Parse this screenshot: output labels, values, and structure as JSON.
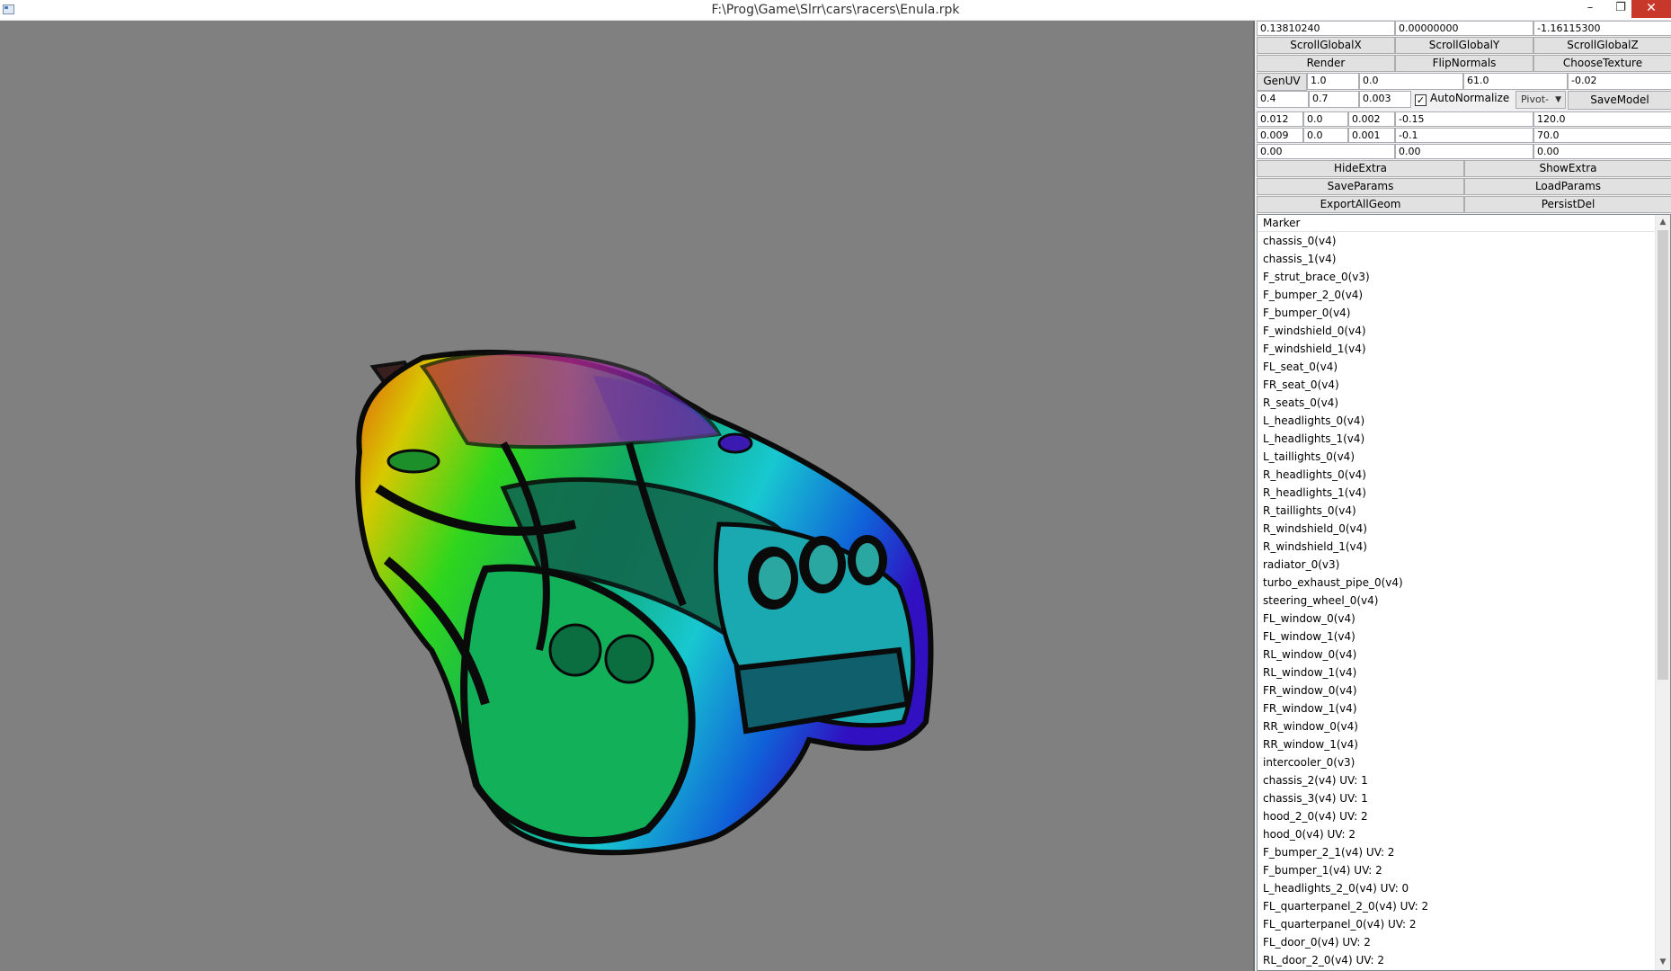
{
  "window": {
    "title": "F:\\Prog\\Game\\Slrr\\cars\\racers\\Enula.rpk",
    "min_glyph": "–",
    "max_glyph": "❐",
    "close_glyph": "✕"
  },
  "panel": {
    "coords": [
      "0.13810240",
      "0.00000000",
      "-1.16115300"
    ],
    "scroll_buttons": [
      "ScrollGlobalX",
      "ScrollGlobalY",
      "ScrollGlobalZ"
    ],
    "action_buttons": [
      "Render",
      "FlipNormals",
      "ChooseTexture"
    ],
    "genuv_label": "GenUV",
    "genuv_row": [
      "1.0",
      "0.0",
      "61.0",
      "-0.02"
    ],
    "param_row": [
      "0.4",
      "0.7",
      "0.003"
    ],
    "autonormalize_label": "AutoNormalize",
    "autonormalize_checked": true,
    "pivot_value": "Pivot-",
    "save_model_label": "SaveModel",
    "row_a": [
      "0.012",
      "0.0",
      "0.002",
      "-0.15",
      "120.0"
    ],
    "row_b": [
      "0.009",
      "0.0",
      "0.001",
      "-0.1",
      "70.0"
    ],
    "row_c": [
      "0.00",
      "0.00",
      "0.00"
    ],
    "hide_extra_label": "HideExtra",
    "show_extra_label": "ShowExtra",
    "save_params_label": "SaveParams",
    "load_params_label": "LoadParams",
    "export_all_geom_label": "ExportAllGeom",
    "persist_del_label": "PersistDel"
  },
  "marker_list": {
    "header": "Marker",
    "items": [
      "chassis_0(v4)",
      "chassis_1(v4)",
      "F_strut_brace_0(v3)",
      "F_bumper_2_0(v4)",
      "F_bumper_0(v4)",
      "F_windshield_0(v4)",
      "F_windshield_1(v4)",
      "FL_seat_0(v4)",
      "FR_seat_0(v4)",
      "R_seats_0(v4)",
      "L_headlights_0(v4)",
      "L_headlights_1(v4)",
      "L_taillights_0(v4)",
      "R_headlights_0(v4)",
      "R_headlights_1(v4)",
      "R_taillights_0(v4)",
      "R_windshield_0(v4)",
      "R_windshield_1(v4)",
      "radiator_0(v3)",
      "turbo_exhaust_pipe_0(v4)",
      "steering_wheel_0(v4)",
      "FL_window_0(v4)",
      "FL_window_1(v4)",
      "RL_window_0(v4)",
      "RL_window_1(v4)",
      "FR_window_0(v4)",
      "FR_window_1(v4)",
      "RR_window_0(v4)",
      "RR_window_1(v4)",
      "intercooler_0(v3)",
      "chassis_2(v4) UV: 1",
      "chassis_3(v4) UV: 1",
      "hood_2_0(v4) UV: 2",
      "hood_0(v4) UV: 2",
      "F_bumper_2_1(v4) UV: 2",
      "F_bumper_1(v4) UV: 2",
      "L_headlights_2_0(v4) UV: 0",
      "FL_quarterpanel_2_0(v4) UV: 2",
      "FL_quarterpanel_0(v4) UV: 2",
      "FL_door_0(v4) UV: 2",
      "RL_door_2_0(v4) UV: 2"
    ]
  },
  "icons": {
    "scroll_up": "▲",
    "scroll_down": "▼",
    "combo_arrow": "▼",
    "check_mark": "✓"
  },
  "colors": {
    "viewport_bg": "#808080",
    "close_button": "#c7382b"
  }
}
